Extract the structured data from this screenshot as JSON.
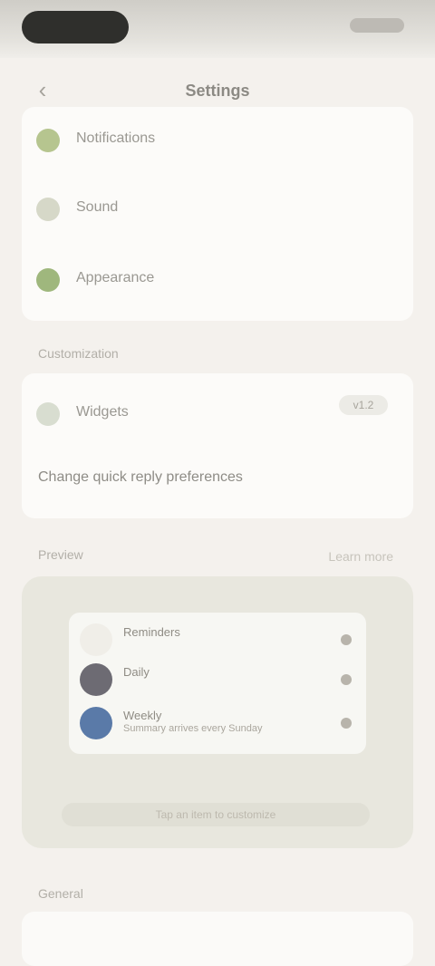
{
  "status": {
    "time": "",
    "right": ""
  },
  "header": {
    "title": "Settings",
    "back_icon": "chevron-left-icon"
  },
  "card1": [
    {
      "label": "Notifications",
      "icon": "bell-icon",
      "color": "#b6c58f"
    },
    {
      "label": "Sound",
      "icon": "speaker-icon",
      "color": "#d6d8c8"
    },
    {
      "label": "Appearance",
      "icon": "palette-icon",
      "color": "#9fb77d"
    }
  ],
  "section2": {
    "label": "Customization"
  },
  "card2": {
    "row": {
      "label": "Widgets",
      "icon": "grid-icon",
      "color": "#d8ddd0"
    },
    "version": "v1.2",
    "hint": "Change quick reply preferences"
  },
  "preview": {
    "label": "Preview",
    "right_label": "Learn more",
    "inner": [
      {
        "title": "Reminders",
        "sub": "",
        "avatar": "#f0eee8"
      },
      {
        "title": "Daily",
        "sub": "",
        "avatar": "#6d6b73"
      },
      {
        "title": "Weekly",
        "sub": "Summary arrives every Sunday",
        "avatar": "#5a7aa8"
      }
    ],
    "note": "Tap an item to customize"
  },
  "section3": {
    "label": "General"
  }
}
